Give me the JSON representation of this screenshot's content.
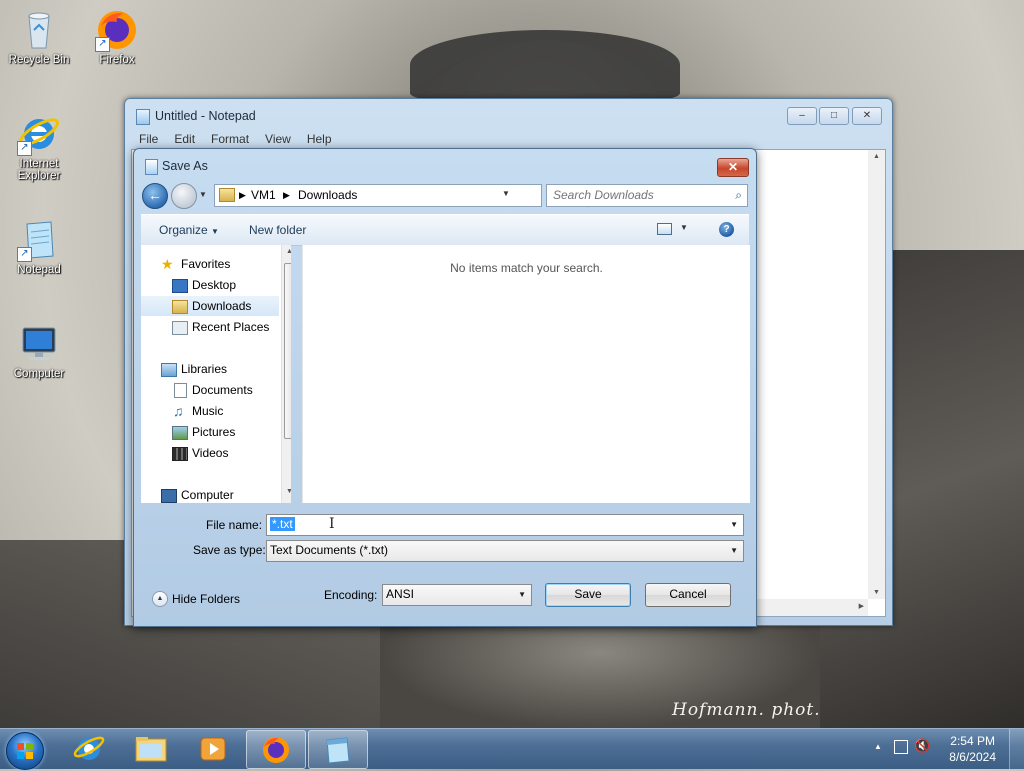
{
  "desktop": {
    "icons": [
      {
        "label": "Recycle Bin"
      },
      {
        "label": "Firefox"
      },
      {
        "label": "Internet Explorer"
      },
      {
        "label": "Notepad"
      },
      {
        "label": "Computer"
      }
    ],
    "photo_credit": "Hofmann. phot."
  },
  "notepad": {
    "title": "Untitled - Notepad",
    "menu": [
      "File",
      "Edit",
      "Format",
      "View",
      "Help"
    ]
  },
  "dialog": {
    "title": "Save As",
    "address": {
      "root": "VM1",
      "current": "Downloads"
    },
    "search_placeholder": "Search Downloads",
    "toolbar": {
      "organize": "Organize",
      "new_folder": "New folder"
    },
    "nav": {
      "favorites": "Favorites",
      "desktop": "Desktop",
      "downloads": "Downloads",
      "recent_places": "Recent Places",
      "libraries": "Libraries",
      "documents": "Documents",
      "music": "Music",
      "pictures": "Pictures",
      "videos": "Videos",
      "computer": "Computer"
    },
    "empty_message": "No items match your search.",
    "file_name_label": "File name:",
    "file_name_value": "*.txt",
    "save_as_type_label": "Save as type:",
    "save_as_type_value": "Text Documents (*.txt)",
    "hide_folders": "Hide Folders",
    "encoding_label": "Encoding:",
    "encoding_value": "ANSI",
    "save_button": "Save",
    "cancel_button": "Cancel"
  },
  "taskbar": {
    "time": "2:54 PM",
    "date": "8/6/2024"
  }
}
